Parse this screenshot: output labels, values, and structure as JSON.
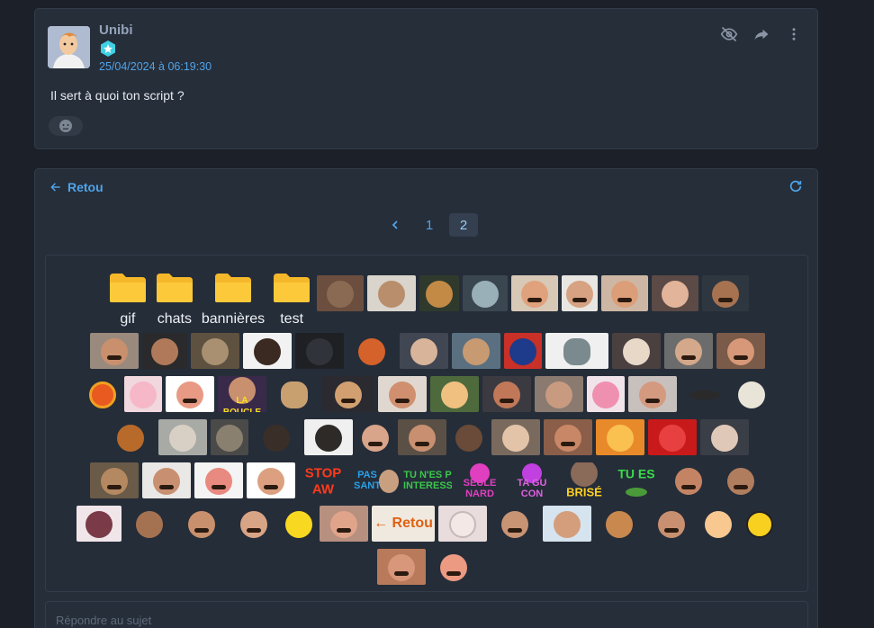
{
  "post": {
    "author": "Unibi",
    "date": "25/04/2024 à 06:19:30",
    "text": "Il sert à quoi ton script ?",
    "actions": [
      "eye-off-icon",
      "share-icon",
      "more-vertical-icon"
    ]
  },
  "stickers_panel": {
    "back_label": "Retou",
    "pages": [
      "1",
      "2"
    ],
    "current_page": "2",
    "folders": [
      "gif",
      "chats",
      "bannières",
      "test"
    ],
    "captions": {
      "la_boucle": "LA BOUCLE",
      "stop": "STOP",
      "aw": "AW",
      "pas_sant": "PAS SANT",
      "tu_nes": "TU N'ES P INTERESS",
      "seule_nard": "SEULE NARD",
      "ta_con": "TA GU CON",
      "brise": "BRISÉ",
      "tu_es": "TU ES",
      "retou_sticker": "← Retou"
    }
  },
  "reply": {
    "placeholder": "Répondre au sujet"
  },
  "colors": {
    "accent": "#4fa3e8",
    "folder": "#f5b82a",
    "background": "#1b2029",
    "card": "#262e3a"
  }
}
